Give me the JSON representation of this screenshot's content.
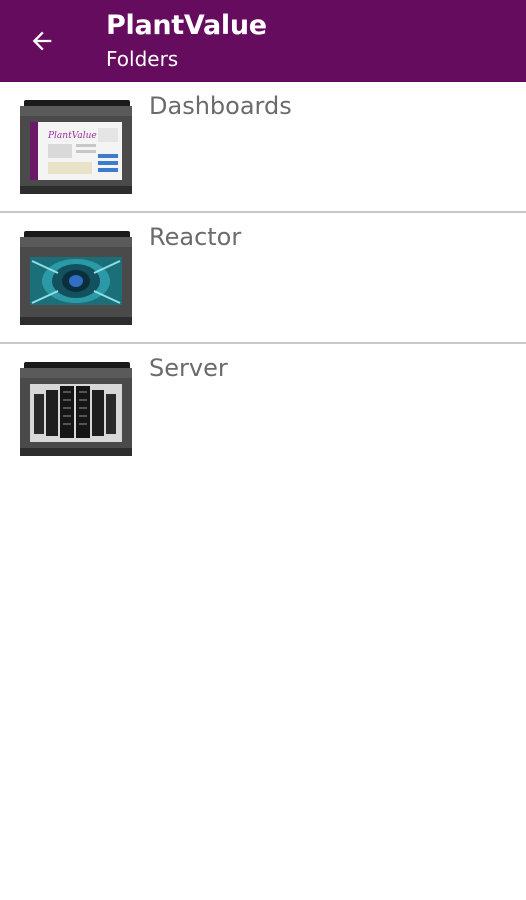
{
  "app_bar": {
    "title": "PlantValue",
    "subtitle": "Folders",
    "background": "#660c5f",
    "back_icon": "arrow-left-icon"
  },
  "folders": [
    {
      "label": "Dashboards",
      "icon": "folder-dashboard-thumbnail-icon"
    },
    {
      "label": "Reactor",
      "icon": "folder-reactor-thumbnail-icon"
    },
    {
      "label": "Server",
      "icon": "folder-server-thumbnail-icon"
    }
  ],
  "colors": {
    "label_text": "#6b6b6b",
    "divider": "#c8c8c8"
  }
}
